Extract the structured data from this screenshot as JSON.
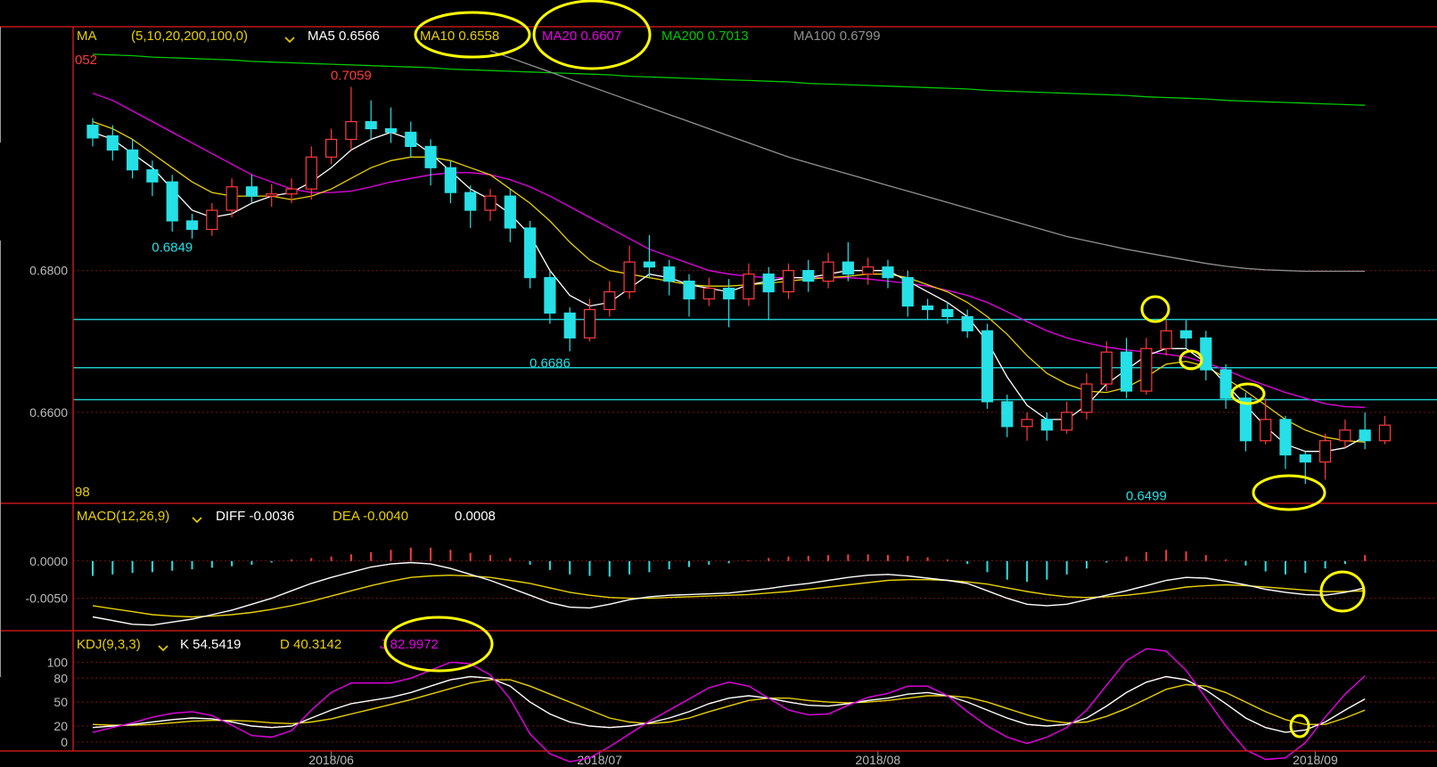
{
  "colors": {
    "bg": "#000000",
    "up": "#ff3b3b",
    "down": "#25e0e6",
    "frame": "#c01818",
    "grid": "#7a1414",
    "ma5": "#ffffff",
    "ma10": "#e8d000",
    "ma20": "#e600e6",
    "ma200": "#00c800",
    "ma100": "#909090",
    "hline": "#20c8cc",
    "label_yellow": "#e8d000",
    "label_white": "#ffffff",
    "annot": "#ffff00"
  },
  "icons": [
    "dropdown-chevron-icon"
  ],
  "ma_panel": {
    "name": "MA",
    "params": "(5,10,20,200,100,0)",
    "ma5": "MA5 0.6566",
    "ma10": "MA10 0.6558",
    "ma20": "MA20 0.6607",
    "ma200": "MA200 0.7013",
    "ma100": "MA100 0.6799",
    "left_top_value": "052",
    "left_bottom_value": "98"
  },
  "macd_panel": {
    "name": "MACD(12,26,9)",
    "diff": "DIFF -0.0036",
    "dea": "DEA -0.0040",
    "macd": "0.0008"
  },
  "kdj_panel": {
    "name": "KDJ(9,3,3)",
    "k": "K 54.5419",
    "d": "D 40.3142",
    "j": "J 82.9972"
  },
  "chart_data": [
    {
      "type": "candlestick",
      "title": "",
      "x_ticks": [
        "2018/06",
        "2018/07",
        "2018/08",
        "2018/09"
      ],
      "y_ticks": [
        "0.6800",
        "0.6600"
      ],
      "ylim": [
        0.6478,
        0.7125
      ],
      "annotations": [
        {
          "text": "0.7059",
          "x": 13,
          "y": 0.7059,
          "position": "above",
          "color": "up"
        },
        {
          "text": "0.6849",
          "x": 4,
          "y": 0.6849,
          "position": "below",
          "color": "down"
        },
        {
          "text": "0.6686",
          "x": 23,
          "y": 0.6686,
          "position": "below",
          "color": "down"
        },
        {
          "text": "0.6499",
          "x": 53,
          "y": 0.6499,
          "position": "below",
          "color": "down"
        }
      ],
      "horizontal_lines": [
        0.6731,
        0.6663,
        0.6618
      ],
      "candles": [
        [
          0.7005,
          0.6987,
          0.7015,
          0.6975
        ],
        [
          0.699,
          0.697,
          0.7005,
          0.6955
        ],
        [
          0.697,
          0.6942,
          0.6985,
          0.693
        ],
        [
          0.6942,
          0.6925,
          0.6955,
          0.6905
        ],
        [
          0.6925,
          0.687,
          0.6935,
          0.6855
        ],
        [
          0.687,
          0.6858,
          0.688,
          0.6845
        ],
        [
          0.6858,
          0.6885,
          0.6895,
          0.6849
        ],
        [
          0.6885,
          0.6918,
          0.693,
          0.6875
        ],
        [
          0.6918,
          0.6905,
          0.6935,
          0.6895
        ],
        [
          0.6905,
          0.6908,
          0.6922,
          0.689
        ],
        [
          0.6908,
          0.6915,
          0.693,
          0.6895
        ],
        [
          0.6915,
          0.696,
          0.6975,
          0.69
        ],
        [
          0.696,
          0.6985,
          0.7,
          0.695
        ],
        [
          0.6985,
          0.701,
          0.7059,
          0.697
        ],
        [
          0.701,
          0.7,
          0.704,
          0.6985
        ],
        [
          0.7,
          0.6995,
          0.703,
          0.698
        ],
        [
          0.6995,
          0.6975,
          0.701,
          0.696
        ],
        [
          0.6975,
          0.6945,
          0.6985,
          0.692
        ],
        [
          0.6945,
          0.691,
          0.6955,
          0.6895
        ],
        [
          0.691,
          0.6885,
          0.692,
          0.686
        ],
        [
          0.6885,
          0.6905,
          0.6915,
          0.687
        ],
        [
          0.6905,
          0.686,
          0.6915,
          0.684
        ],
        [
          0.686,
          0.679,
          0.687,
          0.6775
        ],
        [
          0.679,
          0.674,
          0.68,
          0.6725
        ],
        [
          0.674,
          0.6705,
          0.6748,
          0.6686
        ],
        [
          0.6705,
          0.6745,
          0.676,
          0.67
        ],
        [
          0.6745,
          0.677,
          0.6785,
          0.6735
        ],
        [
          0.677,
          0.6812,
          0.6835,
          0.676
        ],
        [
          0.6812,
          0.6805,
          0.685,
          0.679
        ],
        [
          0.6805,
          0.6785,
          0.6815,
          0.6765
        ],
        [
          0.6785,
          0.676,
          0.6795,
          0.6735
        ],
        [
          0.676,
          0.6775,
          0.679,
          0.675
        ],
        [
          0.6775,
          0.676,
          0.6788,
          0.672
        ],
        [
          0.676,
          0.6795,
          0.681,
          0.675
        ],
        [
          0.6795,
          0.677,
          0.6805,
          0.673
        ],
        [
          0.677,
          0.68,
          0.681,
          0.676
        ],
        [
          0.68,
          0.6785,
          0.6815,
          0.677
        ],
        [
          0.6785,
          0.6812,
          0.6825,
          0.6775
        ],
        [
          0.6812,
          0.6795,
          0.684,
          0.6785
        ],
        [
          0.6795,
          0.6805,
          0.6818,
          0.678
        ],
        [
          0.6805,
          0.679,
          0.6815,
          0.6775
        ],
        [
          0.679,
          0.675,
          0.68,
          0.6735
        ],
        [
          0.675,
          0.6745,
          0.676,
          0.673
        ],
        [
          0.6745,
          0.6735,
          0.6755,
          0.6725
        ],
        [
          0.6735,
          0.6715,
          0.6745,
          0.6705
        ],
        [
          0.6715,
          0.6615,
          0.6725,
          0.6605
        ],
        [
          0.6615,
          0.658,
          0.6625,
          0.6565
        ],
        [
          0.658,
          0.659,
          0.66,
          0.656
        ],
        [
          0.659,
          0.6575,
          0.66,
          0.656
        ],
        [
          0.6575,
          0.66,
          0.6615,
          0.657
        ],
        [
          0.66,
          0.664,
          0.6655,
          0.659
        ],
        [
          0.664,
          0.6685,
          0.67,
          0.663
        ],
        [
          0.6685,
          0.663,
          0.6705,
          0.662
        ],
        [
          0.663,
          0.669,
          0.6705,
          0.6625
        ],
        [
          0.669,
          0.6715,
          0.673,
          0.668
        ],
        [
          0.6715,
          0.6705,
          0.673,
          0.669
        ],
        [
          0.6705,
          0.666,
          0.6715,
          0.6645
        ],
        [
          0.666,
          0.662,
          0.6668,
          0.6605
        ],
        [
          0.662,
          0.656,
          0.6628,
          0.6545
        ],
        [
          0.656,
          0.659,
          0.662,
          0.6555
        ],
        [
          0.659,
          0.654,
          0.6595,
          0.652
        ],
        [
          0.654,
          0.653,
          0.6545,
          0.6499
        ],
        [
          0.653,
          0.656,
          0.657,
          0.6505
        ],
        [
          0.656,
          0.6575,
          0.659,
          0.655
        ],
        [
          0.6575,
          0.656,
          0.66,
          0.6548
        ],
        [
          0.656,
          0.6582,
          0.6595,
          0.6555
        ]
      ],
      "ma5": [
        0.6995,
        0.6985,
        0.6965,
        0.6945,
        0.6915,
        0.6885,
        0.6875,
        0.688,
        0.6895,
        0.6905,
        0.691,
        0.6925,
        0.6945,
        0.697,
        0.6985,
        0.6995,
        0.6985,
        0.6965,
        0.694,
        0.6915,
        0.69,
        0.688,
        0.685,
        0.68,
        0.6765,
        0.675,
        0.6755,
        0.6775,
        0.6795,
        0.679,
        0.678,
        0.6775,
        0.677,
        0.678,
        0.6785,
        0.679,
        0.679,
        0.6795,
        0.68,
        0.68,
        0.68,
        0.6785,
        0.677,
        0.6755,
        0.6735,
        0.67,
        0.665,
        0.661,
        0.659,
        0.659,
        0.661,
        0.664,
        0.666,
        0.668,
        0.669,
        0.669,
        0.667,
        0.664,
        0.661,
        0.658,
        0.6555,
        0.6545,
        0.6545,
        0.655,
        0.6566
      ],
      "ma10": [
        0.701,
        0.7,
        0.6985,
        0.6965,
        0.6945,
        0.6925,
        0.691,
        0.6905,
        0.6905,
        0.6905,
        0.69,
        0.6905,
        0.6915,
        0.693,
        0.6945,
        0.6955,
        0.696,
        0.696,
        0.6955,
        0.6945,
        0.6935,
        0.6915,
        0.6895,
        0.687,
        0.684,
        0.6815,
        0.68,
        0.6795,
        0.679,
        0.6785,
        0.678,
        0.6778,
        0.6778,
        0.678,
        0.6782,
        0.6785,
        0.6788,
        0.679,
        0.6792,
        0.6795,
        0.6795,
        0.679,
        0.678,
        0.677,
        0.6755,
        0.6735,
        0.671,
        0.668,
        0.6655,
        0.664,
        0.663,
        0.6628,
        0.6635,
        0.665,
        0.6668,
        0.6672,
        0.6665,
        0.6648,
        0.663,
        0.661,
        0.659,
        0.6575,
        0.6565,
        0.656,
        0.6558
      ],
      "ma20": [
        0.705,
        0.704,
        0.7025,
        0.701,
        0.6995,
        0.698,
        0.6965,
        0.695,
        0.6935,
        0.6925,
        0.6915,
        0.691,
        0.691,
        0.6912,
        0.6918,
        0.6925,
        0.693,
        0.6935,
        0.6938,
        0.6938,
        0.6935,
        0.6928,
        0.6918,
        0.6905,
        0.689,
        0.6875,
        0.686,
        0.6845,
        0.683,
        0.682,
        0.681,
        0.68,
        0.6795,
        0.6792,
        0.679,
        0.679,
        0.679,
        0.679,
        0.679,
        0.6788,
        0.6785,
        0.6782,
        0.6778,
        0.6772,
        0.6765,
        0.6755,
        0.6742,
        0.6728,
        0.6715,
        0.6705,
        0.6698,
        0.6692,
        0.6688,
        0.6685,
        0.6682,
        0.6678,
        0.667,
        0.666,
        0.6648,
        0.6638,
        0.6628,
        0.662,
        0.6612,
        0.6608,
        0.6607
      ],
      "ma200": [
        0.7105,
        0.7104,
        0.7103,
        0.7101,
        0.71,
        0.7099,
        0.7098,
        0.7097,
        0.7095,
        0.7094,
        0.7093,
        0.7092,
        0.7091,
        0.709,
        0.7089,
        0.7088,
        0.7087,
        0.7086,
        0.7084,
        0.7083,
        0.7082,
        0.7081,
        0.708,
        0.7079,
        0.7078,
        0.7077,
        0.7076,
        0.7074,
        0.7073,
        0.7072,
        0.7071,
        0.707,
        0.7069,
        0.7068,
        0.7067,
        0.7066,
        0.7064,
        0.7063,
        0.7062,
        0.7061,
        0.706,
        0.7059,
        0.7058,
        0.7057,
        0.7056,
        0.7054,
        0.7053,
        0.7052,
        0.7051,
        0.705,
        0.7049,
        0.7048,
        0.7047,
        0.7045,
        0.7044,
        0.7043,
        0.7042,
        0.704,
        0.7039,
        0.7038,
        0.7037,
        0.7036,
        0.7035,
        0.7034,
        0.7033
      ],
      "ma100": [
        null,
        null,
        null,
        null,
        null,
        null,
        null,
        null,
        null,
        null,
        null,
        null,
        null,
        null,
        null,
        null,
        null,
        null,
        null,
        null,
        0.711,
        0.71,
        0.709,
        0.708,
        0.707,
        0.706,
        0.705,
        0.704,
        0.703,
        0.702,
        0.701,
        0.7,
        0.699,
        0.698,
        0.697,
        0.696,
        0.6952,
        0.6944,
        0.6936,
        0.6928,
        0.692,
        0.6912,
        0.6904,
        0.6896,
        0.6888,
        0.688,
        0.6872,
        0.6864,
        0.6856,
        0.6848,
        0.6842,
        0.6836,
        0.683,
        0.6825,
        0.682,
        0.6815,
        0.681,
        0.6806,
        0.6803,
        0.6801,
        0.68,
        0.6799,
        0.6799,
        0.6799,
        0.6799
      ]
    },
    {
      "type": "bar",
      "title": "MACD(12,26,9)",
      "y_ticks": [
        "0.0000",
        "-0.0050"
      ],
      "ylim": [
        -0.009,
        0.005
      ],
      "histogram": [
        -0.002,
        -0.0018,
        -0.0016,
        -0.0015,
        -0.0013,
        -0.0011,
        -0.0009,
        -0.0007,
        -0.0005,
        -0.0002,
        0.0002,
        0.0004,
        0.0006,
        0.0009,
        0.0012,
        0.0015,
        0.0018,
        0.0018,
        0.0015,
        0.0011,
        0.0008,
        0.0004,
        -0.0005,
        -0.0012,
        -0.0018,
        -0.002,
        -0.0021,
        -0.0018,
        -0.0015,
        -0.0011,
        -0.0008,
        -0.0005,
        -0.0003,
        0.0001,
        0.0004,
        0.0006,
        0.0007,
        0.0008,
        0.0009,
        0.0009,
        0.0008,
        0.0007,
        0.0005,
        0.0002,
        -0.0004,
        -0.0015,
        -0.0025,
        -0.0028,
        -0.0025,
        -0.0018,
        -0.001,
        -0.0002,
        0.0006,
        0.0012,
        0.0015,
        0.0013,
        0.0008,
        0.0002,
        -0.0006,
        -0.0014,
        -0.0018,
        -0.0016,
        -0.001,
        -0.0004,
        0.0008
      ],
      "diff": [
        -0.0075,
        -0.008,
        -0.0085,
        -0.0086,
        -0.0082,
        -0.0078,
        -0.0072,
        -0.0066,
        -0.0058,
        -0.005,
        -0.004,
        -0.003,
        -0.0022,
        -0.0015,
        -0.0008,
        -0.0004,
        -0.0002,
        -0.0004,
        -0.001,
        -0.0018,
        -0.0026,
        -0.0036,
        -0.0046,
        -0.0056,
        -0.0062,
        -0.0063,
        -0.0058,
        -0.0052,
        -0.0048,
        -0.0046,
        -0.0045,
        -0.0044,
        -0.0043,
        -0.004,
        -0.0037,
        -0.0033,
        -0.003,
        -0.0026,
        -0.0022,
        -0.0019,
        -0.0018,
        -0.002,
        -0.0023,
        -0.0026,
        -0.003,
        -0.004,
        -0.005,
        -0.0058,
        -0.006,
        -0.0058,
        -0.0052,
        -0.0046,
        -0.004,
        -0.0033,
        -0.0026,
        -0.0022,
        -0.0023,
        -0.0027,
        -0.0032,
        -0.0038,
        -0.0042,
        -0.0045,
        -0.0046,
        -0.0042,
        -0.0036
      ],
      "dea": [
        -0.006,
        -0.0064,
        -0.0068,
        -0.0072,
        -0.0074,
        -0.0075,
        -0.0074,
        -0.0072,
        -0.0069,
        -0.0065,
        -0.006,
        -0.0054,
        -0.0047,
        -0.004,
        -0.0033,
        -0.0027,
        -0.0022,
        -0.002,
        -0.0019,
        -0.002,
        -0.0022,
        -0.0026,
        -0.003,
        -0.0036,
        -0.0042,
        -0.0046,
        -0.0049,
        -0.005,
        -0.005,
        -0.0049,
        -0.0048,
        -0.0047,
        -0.0046,
        -0.0045,
        -0.0043,
        -0.0041,
        -0.0038,
        -0.0035,
        -0.0032,
        -0.0029,
        -0.0026,
        -0.0025,
        -0.0025,
        -0.0026,
        -0.0028,
        -0.0031,
        -0.0036,
        -0.0041,
        -0.0045,
        -0.0048,
        -0.0049,
        -0.0048,
        -0.0046,
        -0.0043,
        -0.0039,
        -0.0035,
        -0.0033,
        -0.0032,
        -0.0033,
        -0.0035,
        -0.0037,
        -0.0039,
        -0.0041,
        -0.0041,
        -0.004
      ]
    },
    {
      "type": "line",
      "title": "KDJ(9,3,3)",
      "y_ticks": [
        "100",
        "80",
        "50",
        "20",
        "0"
      ],
      "ylim": [
        -8,
        115
      ],
      "k": [
        18,
        20,
        22,
        25,
        28,
        30,
        29,
        25,
        20,
        18,
        20,
        30,
        40,
        48,
        52,
        56,
        62,
        70,
        78,
        82,
        80,
        70,
        50,
        35,
        25,
        20,
        18,
        20,
        24,
        30,
        38,
        48,
        55,
        58,
        55,
        50,
        46,
        45,
        48,
        52,
        55,
        60,
        62,
        58,
        50,
        40,
        30,
        22,
        20,
        22,
        30,
        45,
        62,
        75,
        82,
        78,
        65,
        48,
        30,
        18,
        12,
        15,
        25,
        40,
        54
      ],
      "d": [
        22,
        21,
        21,
        22,
        24,
        26,
        27,
        27,
        26,
        24,
        23,
        25,
        29,
        35,
        41,
        47,
        53,
        60,
        67,
        74,
        78,
        78,
        70,
        60,
        50,
        40,
        30,
        25,
        23,
        25,
        30,
        38,
        45,
        52,
        55,
        55,
        52,
        50,
        49,
        50,
        52,
        55,
        58,
        58,
        56,
        50,
        42,
        34,
        27,
        24,
        25,
        32,
        42,
        54,
        66,
        72,
        70,
        62,
        50,
        38,
        28,
        22,
        22,
        30,
        40
      ],
      "j": [
        12,
        18,
        24,
        31,
        36,
        38,
        33,
        21,
        8,
        6,
        14,
        40,
        62,
        74,
        74,
        74,
        80,
        90,
        100,
        98,
        84,
        54,
        10,
        -15,
        -25,
        -20,
        -6,
        10,
        26,
        40,
        54,
        68,
        75,
        70,
        55,
        40,
        34,
        35,
        46,
        56,
        61,
        70,
        70,
        58,
        38,
        20,
        6,
        -2,
        6,
        18,
        40,
        71,
        102,
        117,
        114,
        90,
        55,
        20,
        -10,
        -22,
        -20,
        -1,
        31,
        60,
        83
      ]
    }
  ]
}
